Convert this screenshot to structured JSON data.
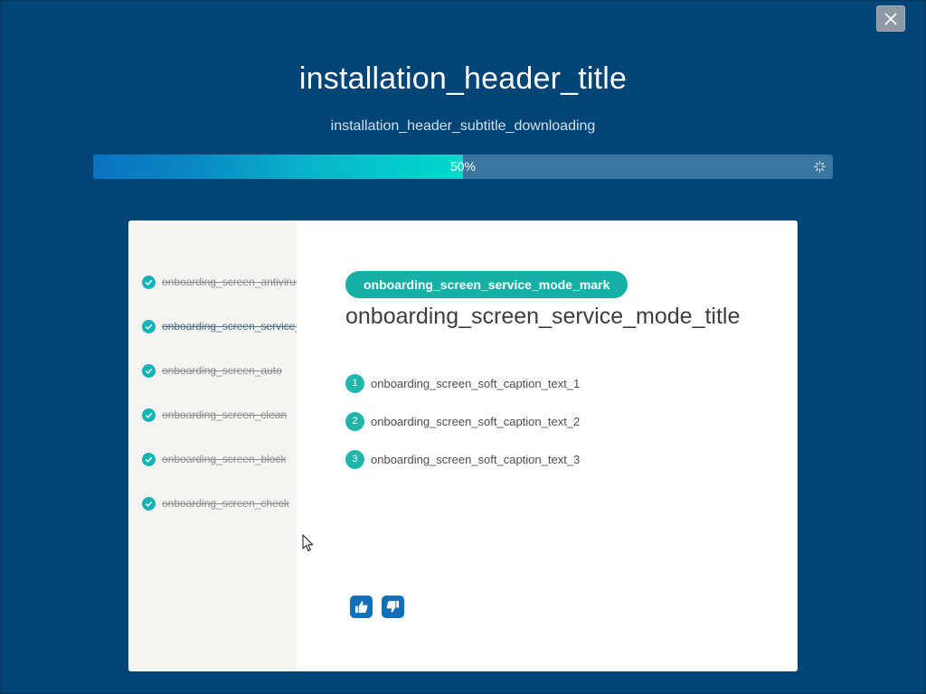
{
  "window": {
    "close_icon": "close-icon"
  },
  "header": {
    "title": "installation_header_title",
    "subtitle": "installation_header_subtitle_downloading"
  },
  "progress": {
    "percent": 50,
    "label": "50%"
  },
  "sidebar": {
    "items": [
      {
        "label": "onboarding_screen_antivirus",
        "done": true
      },
      {
        "label": "onboarding_screen_service_mode",
        "done": true,
        "active": true
      },
      {
        "label": "onboarding_screen_auto",
        "done": true
      },
      {
        "label": "onboarding_screen_clean",
        "done": true
      },
      {
        "label": "onboarding_screen_block",
        "done": true
      },
      {
        "label": "onboarding_screen_check",
        "done": true
      }
    ]
  },
  "content": {
    "mark": "onboarding_screen_service_mode_mark",
    "title": "onboarding_screen_service_mode_title",
    "steps": [
      {
        "num": "1",
        "text": "onboarding_screen_soft_caption_text_1"
      },
      {
        "num": "2",
        "text": "onboarding_screen_soft_caption_text_2"
      },
      {
        "num": "3",
        "text": "onboarding_screen_soft_caption_text_3"
      }
    ]
  },
  "feedback": {
    "like_icon": "thumbs-up-icon",
    "dislike_icon": "thumbs-down-icon"
  },
  "colors": {
    "background": "#004576",
    "accent_teal": "#16b0a6",
    "accent_blue": "#0f6fb8",
    "progress_track": "#3a76a0"
  }
}
